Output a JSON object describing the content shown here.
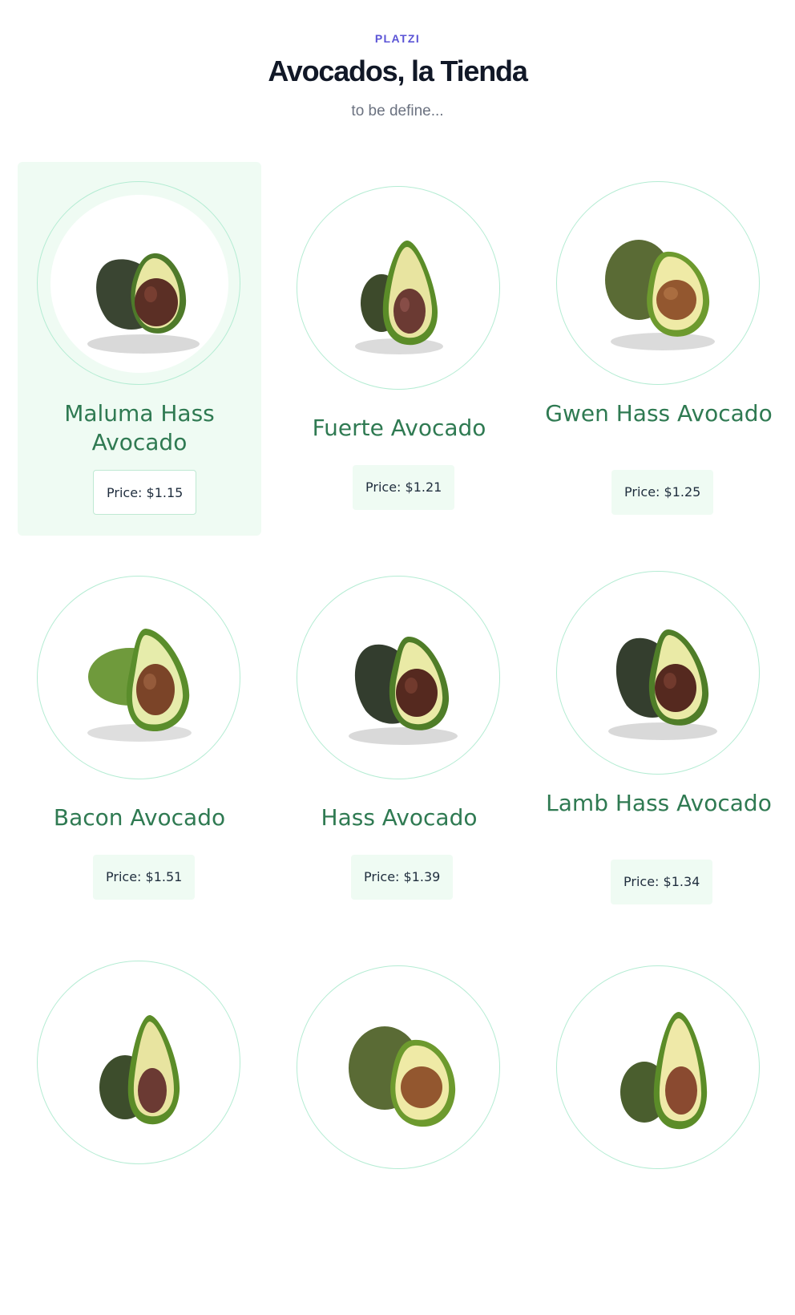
{
  "header": {
    "eyebrow": "PLATZI",
    "title": "Avocados, la Tienda",
    "subtitle": "to be define..."
  },
  "products": [
    {
      "name": "Maluma Hass Avocado",
      "price": "Price: $1.15",
      "selected": true
    },
    {
      "name": "Fuerte Avocado",
      "price": "Price: $1.21",
      "selected": false
    },
    {
      "name": "Gwen Hass Avocado",
      "price": "Price: $1.25",
      "selected": false
    },
    {
      "name": "Bacon Avocado",
      "price": "Price: $1.51",
      "selected": false
    },
    {
      "name": "Hass Avocado",
      "price": "Price: $1.39",
      "selected": false
    },
    {
      "name": "Lamb Hass Avocado",
      "price": "Price: $1.34",
      "selected": false
    },
    {
      "name": "",
      "price": "",
      "selected": false
    },
    {
      "name": "",
      "price": "",
      "selected": false
    },
    {
      "name": "",
      "price": "",
      "selected": false
    }
  ],
  "colors": {
    "accent": "#5b54d6",
    "product_name": "#2f7a52",
    "card_highlight": "#effbf3",
    "circle_border": "#b4ecd3"
  }
}
